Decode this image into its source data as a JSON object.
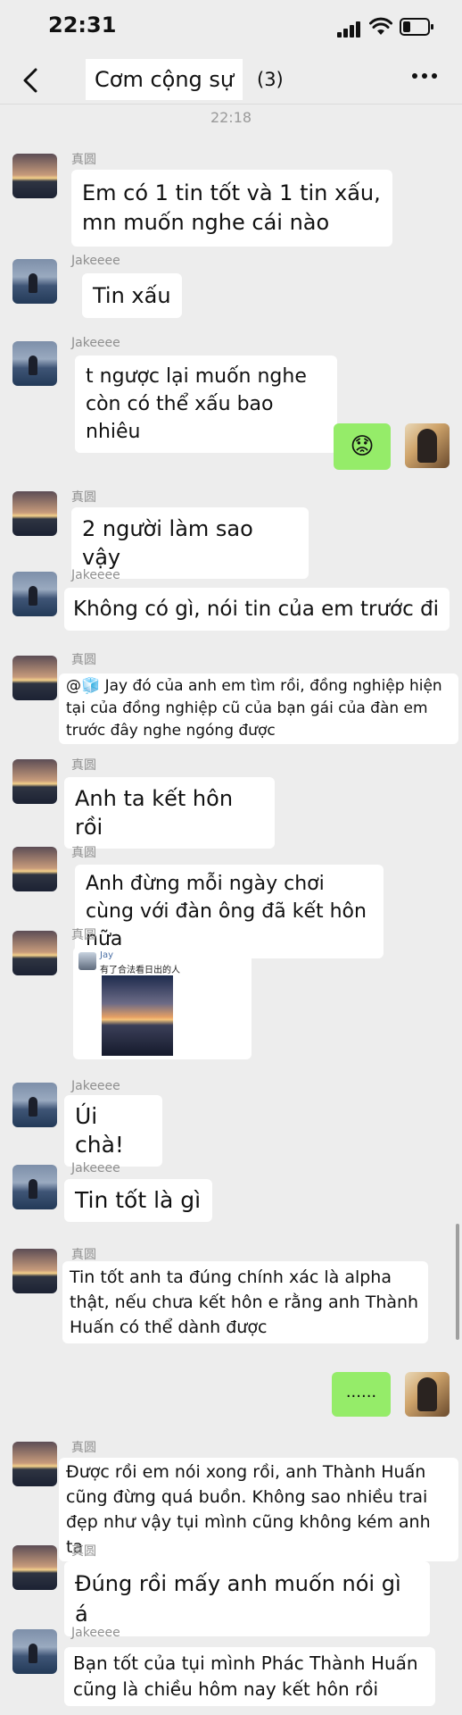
{
  "status": {
    "time": "22:31"
  },
  "header": {
    "title": "Cơm cộng sự",
    "member_count": "(3)"
  },
  "timestamp": "22:18",
  "messages": [
    {
      "sender": "真圆",
      "text": "Em có 1 tin tốt và 1 tin xấu, mn muốn nghe cái nào"
    },
    {
      "sender": "Jakeeee",
      "text": "Tin xấu"
    },
    {
      "sender": "Jakeeee",
      "text": "t ngược lại muốn nghe còn có thể xấu bao nhiêu"
    },
    {
      "sender": "me",
      "text": "😟"
    },
    {
      "sender": "真圆",
      "text": "2 người làm sao vậy"
    },
    {
      "sender": "Jakeeee",
      "text": "Không có gì, nói tin của em trước đi"
    },
    {
      "sender": "真圆",
      "text": "@🧊 Jay đó của anh em tìm rồi, đồng nghiệp hiện tại của đồng nghiệp cũ của bạn gái của đàn em trước đây nghe ngóng được"
    },
    {
      "sender": "真圆",
      "text": "Anh ta kết hôn rồi"
    },
    {
      "sender": "真圆",
      "text": "Anh đừng mỗi ngày chơi cùng với đàn ông đã kết hôn nữa"
    },
    {
      "sender": "真圆",
      "share_name": "Jay",
      "share_caption": "有了合法看日出的人"
    },
    {
      "sender": "Jakeeee",
      "text": "Úi chà!"
    },
    {
      "sender": "Jakeeee",
      "text": "Tin tốt là gì"
    },
    {
      "sender": "真圆",
      "text": "Tin tốt anh ta đúng chính xác là alpha thật, nếu chưa kết hôn e rằng anh Thành Huấn có thể dành được"
    },
    {
      "sender": "me",
      "text": "......"
    },
    {
      "sender": "真圆",
      "text": "Được rồi em nói xong rồi, anh Thành Huấn cũng đừng quá buồn. Không sao nhiều trai đẹp như vậy tụi mình cũng không kém anh ta"
    },
    {
      "sender": "真圆",
      "text": "Đúng rồi mấy anh muốn nói gì á"
    },
    {
      "sender": "Jakeeee",
      "text": "Bạn tốt của tụi mình Phác Thành Huấn cũng là chiều hôm nay kết hôn rồi"
    }
  ]
}
